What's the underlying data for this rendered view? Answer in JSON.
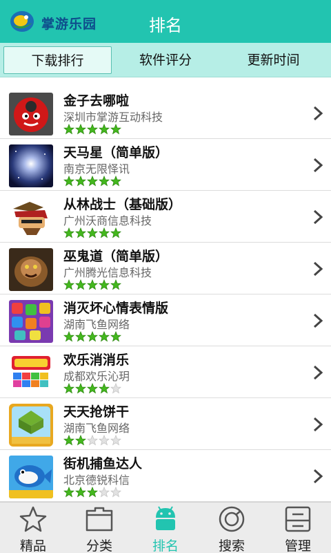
{
  "header": {
    "app_name": "掌游乐园",
    "title": "排名"
  },
  "tabs": [
    {
      "label": "下载排行",
      "active": true
    },
    {
      "label": "软件评分",
      "active": false
    },
    {
      "label": "更新时间",
      "active": false
    }
  ],
  "apps": [
    {
      "name": "金子去哪啦",
      "company": "深圳市掌游互动科技",
      "rating": 5,
      "icon": "red-bird-icon"
    },
    {
      "name": "天马星（简单版）",
      "company": "南京无限怿讯",
      "rating": 5,
      "icon": "galaxy-icon"
    },
    {
      "name": "从林战士（基础版）",
      "company": "广州沃商信息科技",
      "rating": 5,
      "icon": "warrior-icon"
    },
    {
      "name": "巫鬼道（简单版）",
      "company": "广州腾光信息科技",
      "rating": 5,
      "icon": "monster-icon"
    },
    {
      "name": "消灭坏心情表情版",
      "company": "湖南飞鱼网络",
      "rating": 5,
      "icon": "emoji-blocks-icon"
    },
    {
      "name": "欢乐消消乐",
      "company": "成都欢乐沁玥",
      "rating": 4,
      "icon": "match-blocks-icon"
    },
    {
      "name": "天天抢饼干",
      "company": "湖南飞鱼网络",
      "rating": 2,
      "icon": "cookie-icon"
    },
    {
      "name": "街机捕鱼达人",
      "company": "北京德锐科信",
      "rating": 3,
      "icon": "fish-icon"
    }
  ],
  "bottom_nav": [
    {
      "label": "精品",
      "icon": "star-icon",
      "active": false
    },
    {
      "label": "分类",
      "icon": "category-icon",
      "active": false
    },
    {
      "label": "排名",
      "icon": "android-icon",
      "active": true
    },
    {
      "label": "搜索",
      "icon": "search-icon",
      "active": false
    },
    {
      "label": "管理",
      "icon": "manage-icon",
      "active": false
    }
  ],
  "colors": {
    "accent": "#22c4b0",
    "star_filled": "#44b81e",
    "star_empty": "#e2e2e2"
  }
}
